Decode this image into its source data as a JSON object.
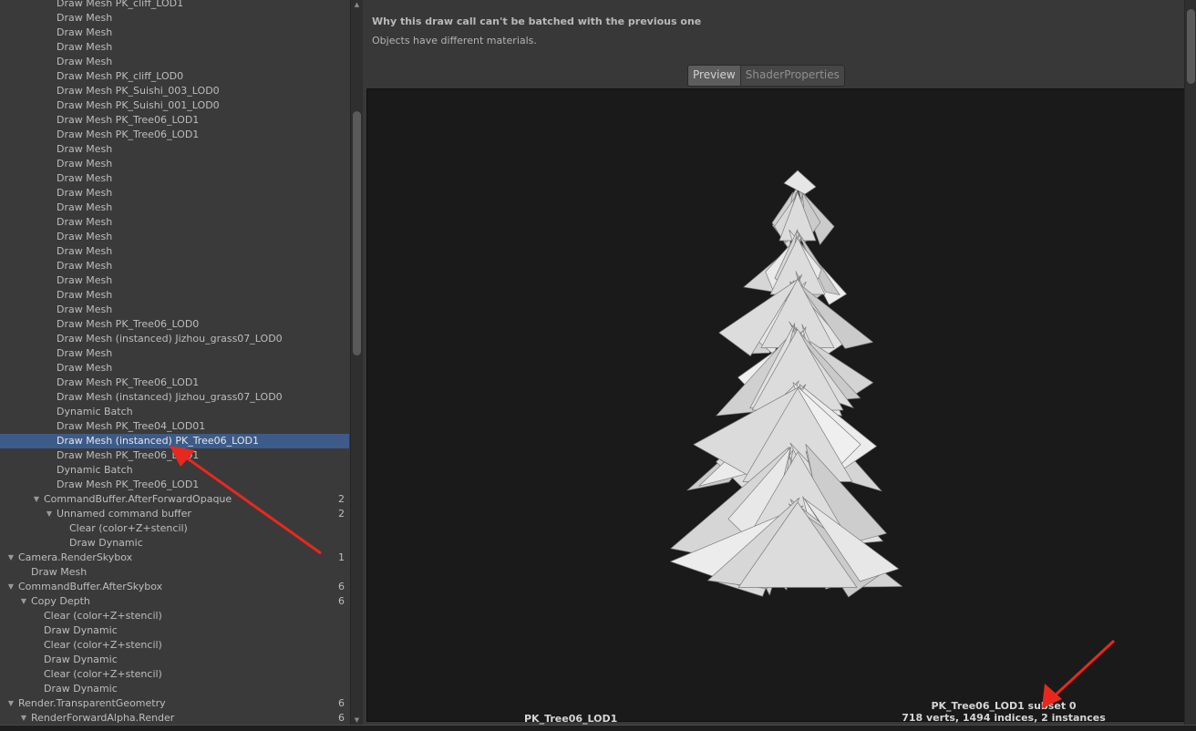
{
  "tree": {
    "rows": [
      {
        "label": "Draw Mesh PK_cliff_LOD1",
        "indent": 62,
        "selected": false
      },
      {
        "label": "Draw Mesh",
        "indent": 62,
        "selected": false
      },
      {
        "label": "Draw Mesh",
        "indent": 62,
        "selected": false
      },
      {
        "label": "Draw Mesh",
        "indent": 62,
        "selected": false
      },
      {
        "label": "Draw Mesh",
        "indent": 62,
        "selected": false
      },
      {
        "label": "Draw Mesh PK_cliff_LOD0",
        "indent": 62,
        "selected": false
      },
      {
        "label": "Draw Mesh PK_Suishi_003_LOD0",
        "indent": 62,
        "selected": false
      },
      {
        "label": "Draw Mesh PK_Suishi_001_LOD0",
        "indent": 62,
        "selected": false
      },
      {
        "label": "Draw Mesh PK_Tree06_LOD1",
        "indent": 62,
        "selected": false
      },
      {
        "label": "Draw Mesh PK_Tree06_LOD1",
        "indent": 62,
        "selected": false
      },
      {
        "label": "Draw Mesh",
        "indent": 62,
        "selected": false
      },
      {
        "label": "Draw Mesh",
        "indent": 62,
        "selected": false
      },
      {
        "label": "Draw Mesh",
        "indent": 62,
        "selected": false
      },
      {
        "label": "Draw Mesh",
        "indent": 62,
        "selected": false
      },
      {
        "label": "Draw Mesh",
        "indent": 62,
        "selected": false
      },
      {
        "label": "Draw Mesh",
        "indent": 62,
        "selected": false
      },
      {
        "label": "Draw Mesh",
        "indent": 62,
        "selected": false
      },
      {
        "label": "Draw Mesh",
        "indent": 62,
        "selected": false
      },
      {
        "label": "Draw Mesh",
        "indent": 62,
        "selected": false
      },
      {
        "label": "Draw Mesh",
        "indent": 62,
        "selected": false
      },
      {
        "label": "Draw Mesh",
        "indent": 62,
        "selected": false
      },
      {
        "label": "Draw Mesh",
        "indent": 62,
        "selected": false
      },
      {
        "label": "Draw Mesh PK_Tree06_LOD0",
        "indent": 62,
        "selected": false
      },
      {
        "label": "Draw Mesh (instanced) Jizhou_grass07_LOD0",
        "indent": 62,
        "selected": false
      },
      {
        "label": "Draw Mesh",
        "indent": 62,
        "selected": false
      },
      {
        "label": "Draw Mesh",
        "indent": 62,
        "selected": false
      },
      {
        "label": "Draw Mesh PK_Tree06_LOD1",
        "indent": 62,
        "selected": false
      },
      {
        "label": "Draw Mesh (instanced) Jizhou_grass07_LOD0",
        "indent": 62,
        "selected": false
      },
      {
        "label": "Dynamic Batch",
        "indent": 62,
        "selected": false
      },
      {
        "label": "Draw Mesh PK_Tree04_LOD01",
        "indent": 62,
        "selected": false
      },
      {
        "label": "Draw Mesh (instanced) PK_Tree06_LOD1",
        "indent": 62,
        "selected": true
      },
      {
        "label": "Draw Mesh PK_Tree06_LOD1",
        "indent": 62,
        "selected": false
      },
      {
        "label": "Dynamic Batch",
        "indent": 62,
        "selected": false
      },
      {
        "label": "Draw Mesh PK_Tree06_LOD1",
        "indent": 62,
        "selected": false
      },
      {
        "label": "CommandBuffer.AfterForwardOpaque",
        "indent": 48,
        "expanded": true,
        "count": "2",
        "selected": false
      },
      {
        "label": "Unnamed command buffer",
        "indent": 62,
        "expanded": true,
        "count": "2",
        "selected": false
      },
      {
        "label": "Clear (color+Z+stencil)",
        "indent": 76,
        "selected": false
      },
      {
        "label": "Draw Dynamic",
        "indent": 76,
        "selected": false
      },
      {
        "label": "Camera.RenderSkybox",
        "indent": 20,
        "expanded": true,
        "count": "1",
        "selected": false
      },
      {
        "label": "Draw Mesh",
        "indent": 34,
        "selected": false
      },
      {
        "label": "CommandBuffer.AfterSkybox",
        "indent": 20,
        "expanded": true,
        "count": "6",
        "selected": false
      },
      {
        "label": "Copy Depth",
        "indent": 34,
        "expanded": true,
        "count": "6",
        "selected": false
      },
      {
        "label": "Clear (color+Z+stencil)",
        "indent": 48,
        "selected": false
      },
      {
        "label": "Draw Dynamic",
        "indent": 48,
        "selected": false
      },
      {
        "label": "Clear (color+Z+stencil)",
        "indent": 48,
        "selected": false
      },
      {
        "label": "Draw Dynamic",
        "indent": 48,
        "selected": false
      },
      {
        "label": "Clear (color+Z+stencil)",
        "indent": 48,
        "selected": false
      },
      {
        "label": "Draw Dynamic",
        "indent": 48,
        "selected": false
      },
      {
        "label": "Render.TransparentGeometry",
        "indent": 20,
        "expanded": true,
        "count": "6",
        "selected": false
      },
      {
        "label": "RenderForwardAlpha.Render",
        "indent": 34,
        "expanded": true,
        "count": "6",
        "selected": false
      }
    ]
  },
  "details": {
    "batch_title": "Why this draw call can't be batched with the previous one",
    "batch_reason": "Objects have different materials."
  },
  "tabs": [
    {
      "label": "Preview",
      "active": true
    },
    {
      "label": "ShaderProperties",
      "active": false
    }
  ],
  "preview": {
    "mesh_name": "PK_Tree06_LOD1",
    "subset": "PK_Tree06_LOD1 subset 0",
    "stats": "718 verts, 1494 indices, 2 instances"
  },
  "colors": {
    "selection": "#3d5b88",
    "annotation_arrow": "#e8281e",
    "mesh_fill": "#e4e4e4"
  },
  "icons": {
    "expand_arrow": "triangle-down-icon",
    "annotation": "red-arrow-icon"
  }
}
